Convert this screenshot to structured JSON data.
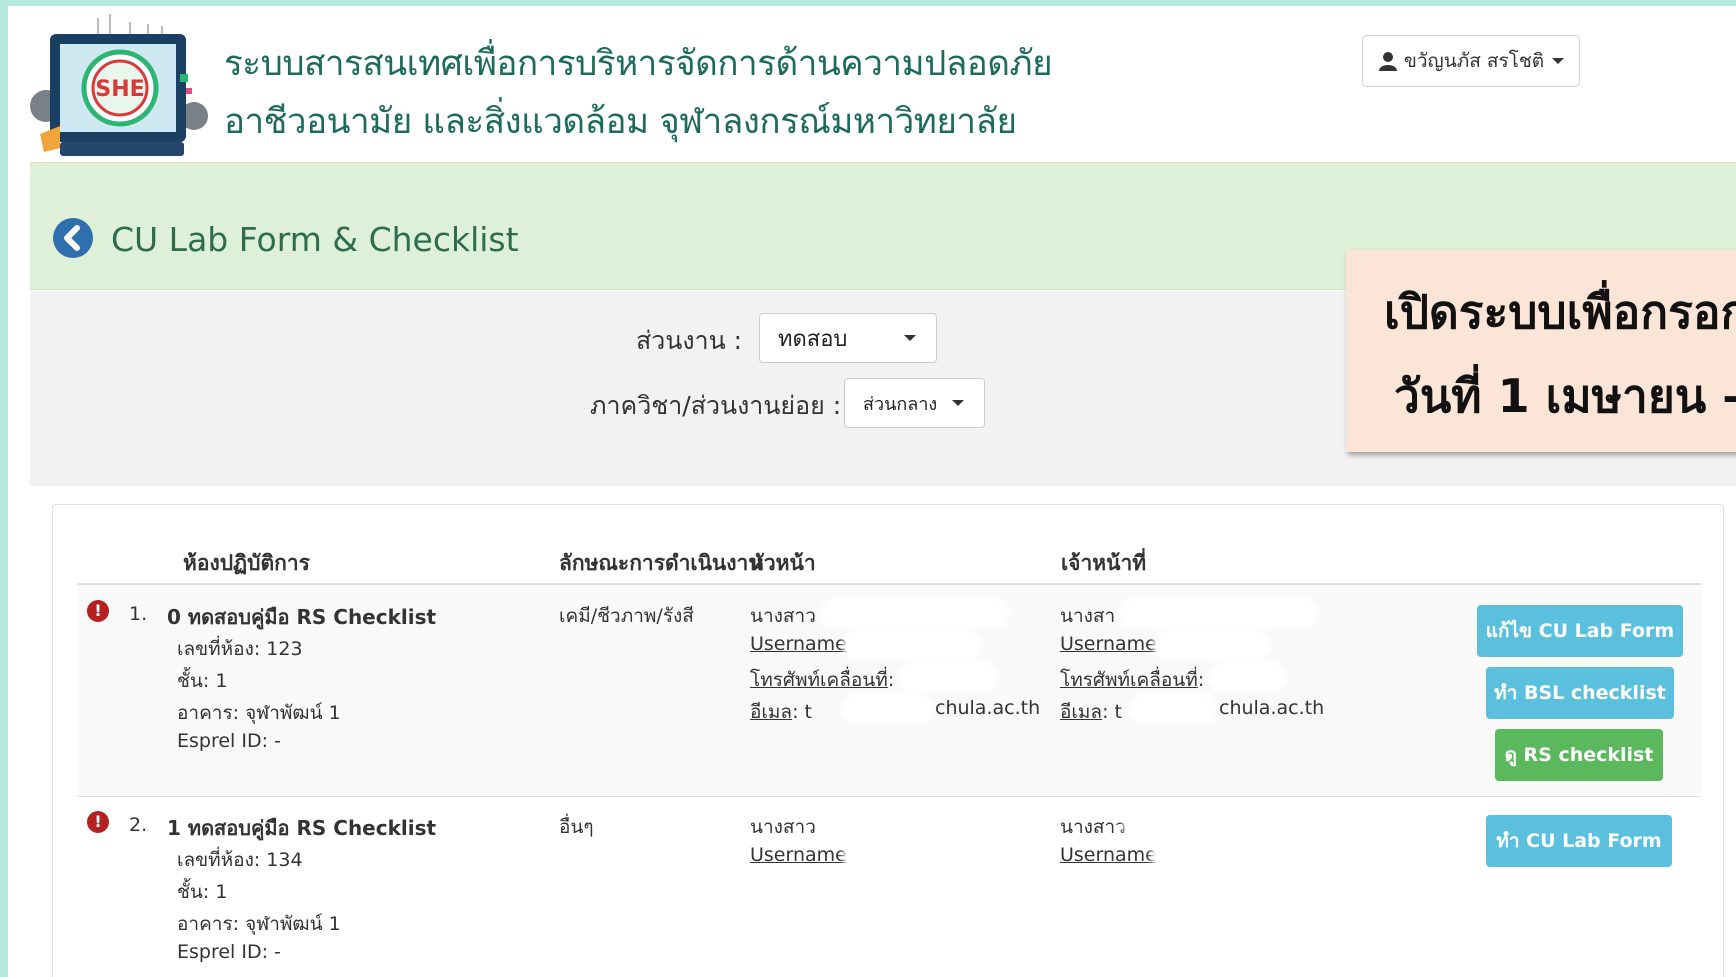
{
  "header": {
    "title_line1": "ระบบสารสนเทศเพื่อการบริหารจัดการด้านความปลอดภัย",
    "title_line2": "อาชีวอนามัย และสิ่งแวดล้อม จุฬาลงกรณ์มหาวิทยาลัย",
    "logo_text": "SHE",
    "user_name": "ขวัญนภัส สรโชติ"
  },
  "page_title": "CU Lab Form & Checklist",
  "filters": {
    "unit_label": "ส่วนงาน :",
    "unit_value": "ทดสอบ",
    "dept_label": "ภาควิชา/ส่วนงานย่อย :",
    "dept_value": "ส่วนกลาง"
  },
  "announcement": {
    "line1": "เปิดระบบเพื่อกรอก",
    "line2": "วันที่ 1 เมษายน –"
  },
  "table": {
    "headers": [
      "ห้องปฏิบัติการ",
      "ลักษณะการดำเนินงาน",
      "หัวหน้า",
      "เจ้าหน้าที่"
    ],
    "rows": [
      {
        "index": "1.",
        "name": "0 ทดสอบคู่มือ RS Checklist",
        "room": "เลขที่ห้อง: 123",
        "floor": "ชั้น: 1",
        "building": "อาคาร: จุฬาพัฒน์ 1",
        "esprel": "Esprel ID: -",
        "nature": "เคมี/ชีวภาพ/รังสี",
        "head": {
          "name": "นางสาว",
          "username_label": "Username",
          "username_value": ": l",
          "phone_label": "โทรศัพท์เคลื่อนที่",
          "phone_value": ": ",
          "email_label": "อีเมล",
          "email_value": ": t",
          "email_domain": "chula.ac.th"
        },
        "staff": {
          "name": "นางสา",
          "username_label": "Username",
          "username_value": ": ",
          "phone_label": "โทรศัพท์เคลื่อนที่",
          "phone_value": ": ",
          "email_label": "อีเมล",
          "email_value": ": t",
          "email_domain": "chula.ac.th"
        },
        "actions": [
          "แก้ไข CU Lab Form",
          "ทำ BSL checklist",
          "ดู RS checklist"
        ]
      },
      {
        "index": "2.",
        "name": "1 ทดสอบคู่มือ RS Checklist",
        "room": "เลขที่ห้อง: 134",
        "floor": "ชั้น: 1",
        "building": "อาคาร: จุฬาพัฒน์ 1",
        "esprel": "Esprel ID: -",
        "nature": "อื่นๆ",
        "head": {
          "name": "นางสาว",
          "username_label": "Username",
          "username_value": ": "
        },
        "staff": {
          "name": "นางสาว",
          "username_label": "Username",
          "username_value": ": h"
        },
        "actions": [
          "ทำ CU Lab Form"
        ]
      }
    ]
  },
  "colors": {
    "title_green": "#1d6b5c",
    "greenbar": "#dff0d8",
    "btn_info": "#5bc0de",
    "btn_success": "#5cb85c",
    "warn_red": "#b52020",
    "announce_bg": "#fbe5d6"
  }
}
